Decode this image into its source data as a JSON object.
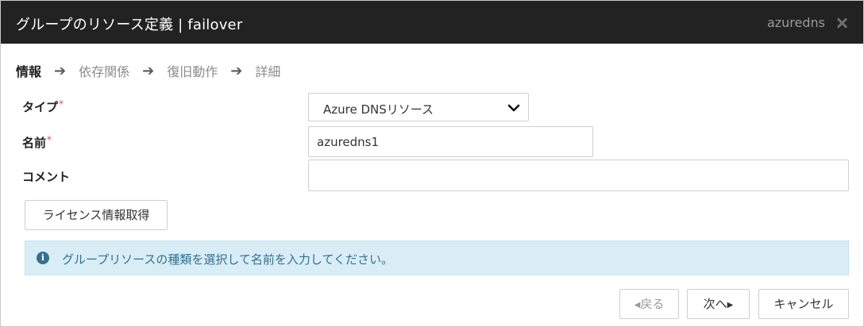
{
  "dialog": {
    "title": "グループのリソース定義 | failover",
    "resource_name": "azuredns",
    "close_icon": "close-icon"
  },
  "steps": [
    {
      "label": "情報",
      "active": true
    },
    {
      "label": "依存関係",
      "active": false
    },
    {
      "label": "復旧動作",
      "active": false
    },
    {
      "label": "詳細",
      "active": false
    }
  ],
  "form": {
    "type_label": "タイプ",
    "type_value": "Azure DNSリソース",
    "name_label": "名前",
    "name_value": "azuredns1",
    "comment_label": "コメント",
    "comment_value": "",
    "required_mark": "*"
  },
  "license_button": "ライセンス情報取得",
  "info": {
    "icon": "info-icon",
    "message": "グループリソースの種類を選択して名前を入力してください。"
  },
  "footer": {
    "back_label": "戻る",
    "next_label": "次へ",
    "cancel_label": "キャンセル"
  },
  "colors": {
    "titlebar": "#222222",
    "info_bg": "#d9edf7",
    "info_text": "#31708f",
    "required": "#d9534f"
  }
}
